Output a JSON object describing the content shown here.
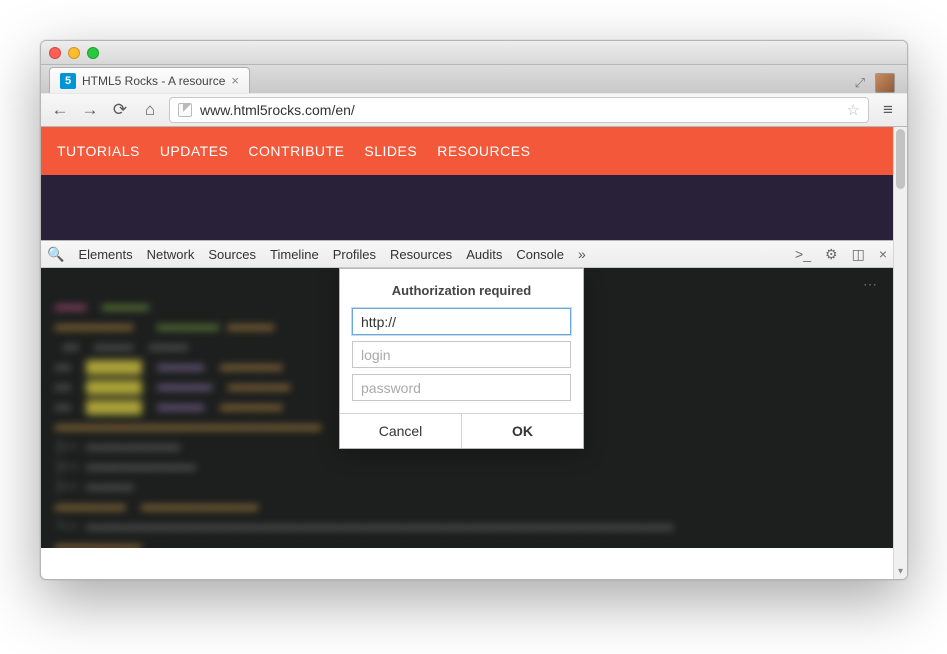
{
  "window": {
    "tab_title": "HTML5 Rocks - A resource",
    "favicon_text": "5"
  },
  "toolbar": {
    "url": "www.html5rocks.com/en/"
  },
  "site_nav": [
    "TUTORIALS",
    "UPDATES",
    "CONTRIBUTE",
    "SLIDES",
    "RESOURCES"
  ],
  "devtools": {
    "tabs": [
      "Elements",
      "Network",
      "Sources",
      "Timeline",
      "Profiles",
      "Resources",
      "Audits",
      "Console"
    ],
    "overflow": "»"
  },
  "dialog": {
    "title": "Authorization required",
    "address_value": "http://",
    "login_placeholder": "login",
    "password_placeholder": "password",
    "cancel": "Cancel",
    "ok": "OK"
  }
}
